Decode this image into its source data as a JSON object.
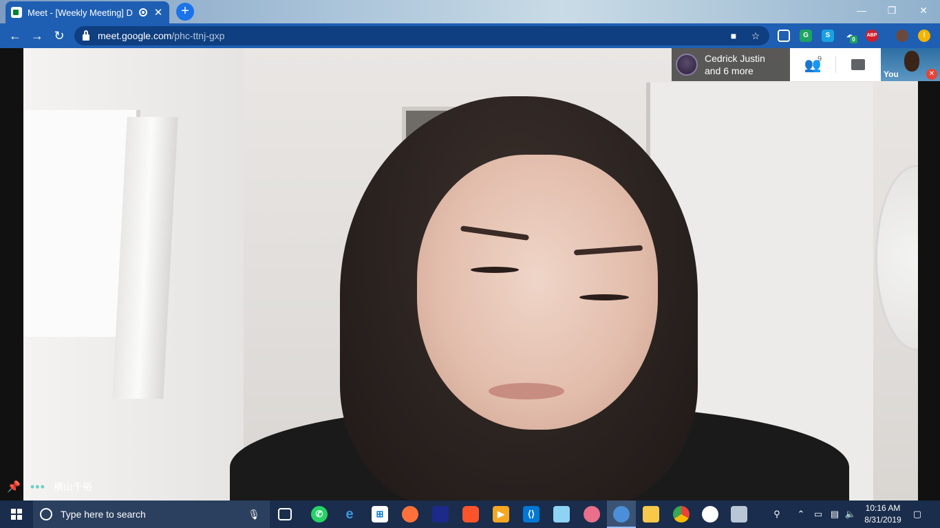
{
  "browser": {
    "tab_title": "Meet - [Weekly Meeting] DIV",
    "tab_close": "✕",
    "new_tab": "+",
    "window_controls": {
      "minimize": "—",
      "restore": "❐",
      "close": "✕"
    },
    "url_host": "meet.google.com",
    "url_path": "/phc-ttnj-gxp",
    "extensions": [
      {
        "name": "picture-in-picture-icon",
        "label": "▭",
        "color": "#1e5fb3"
      },
      {
        "name": "grammar-extension-icon",
        "label": "G",
        "color": "#1ea362"
      },
      {
        "name": "skype-extension-icon",
        "label": "S",
        "color": "#1aa1e1"
      },
      {
        "name": "cloud-extension-icon",
        "label": "☁",
        "color": "#1e5fb3",
        "badge": "0"
      },
      {
        "name": "adblock-extension-icon",
        "label": "ABP",
        "color": "#d21f2b"
      }
    ]
  },
  "meet": {
    "participants_name": "Cedrick Justin",
    "participants_more": "and 6 more",
    "people_count": "9",
    "self_label": "You",
    "speaker_name": "横山千裕"
  },
  "taskbar": {
    "search_placeholder": "Type here to search",
    "time": "10:16 AM",
    "date": "8/31/2019"
  }
}
